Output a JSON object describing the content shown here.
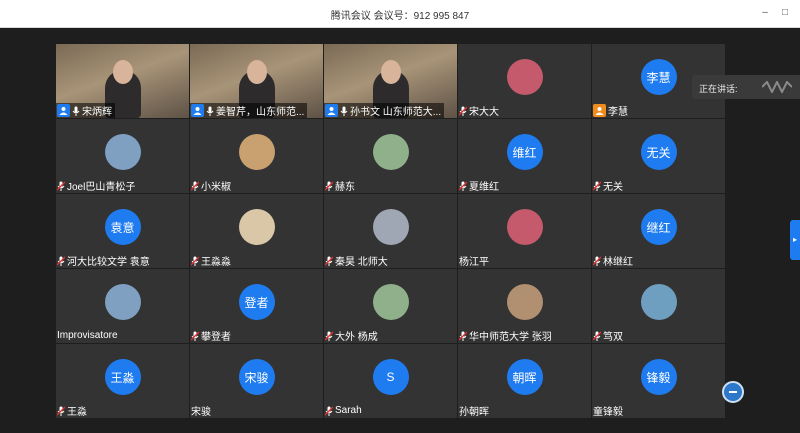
{
  "window": {
    "title": "腾讯会议 会议号：912 995 847",
    "minimize": "–",
    "maximize": "□"
  },
  "speaking": {
    "label": "正在讲话:"
  },
  "colors": {
    "avatar_blue": "#1f7cf0",
    "tile_bg": "#333334",
    "stage_bg": "#1e1e1e",
    "host_orange": "#f08c1e"
  },
  "participants": [
    {
      "name": "宋炳辉",
      "kind": "video",
      "host": true,
      "mic": "on"
    },
    {
      "name": "姜智芹，山东师范...",
      "kind": "video",
      "host": true,
      "mic": "on"
    },
    {
      "name": "孙书文 山东师范大...",
      "kind": "video",
      "host": true,
      "mic": "on"
    },
    {
      "name": "宋大大",
      "kind": "photo",
      "mic": "muted"
    },
    {
      "name": "李慧",
      "kind": "text",
      "avatar_text": "李慧",
      "host_orange": true
    },
    {
      "name": "Joel巴山青松子",
      "kind": "photo",
      "mic": "muted"
    },
    {
      "name": "小米椒",
      "kind": "photo",
      "mic": "muted"
    },
    {
      "name": "赫东",
      "kind": "photo",
      "mic": "muted"
    },
    {
      "name": "夏维红",
      "kind": "text",
      "avatar_text": "维红",
      "mic": "muted"
    },
    {
      "name": "无关",
      "kind": "text",
      "avatar_text": "无关",
      "mic": "muted"
    },
    {
      "name": "河大比较文学 袁意",
      "kind": "text",
      "avatar_text": "袁意",
      "mic": "muted"
    },
    {
      "name": "王淼淼",
      "kind": "photo",
      "mic": "muted"
    },
    {
      "name": "秦昊 北师大",
      "kind": "photo",
      "mic": "muted"
    },
    {
      "name": "杨江平",
      "kind": "photo"
    },
    {
      "name": "林继红",
      "kind": "text",
      "avatar_text": "继红",
      "mic": "muted"
    },
    {
      "name": "Improvisatore",
      "kind": "photo"
    },
    {
      "name": "攀登者",
      "kind": "text",
      "avatar_text": "登者",
      "mic": "muted"
    },
    {
      "name": "大外  杨成",
      "kind": "photo",
      "mic": "muted"
    },
    {
      "name": "华中师范大学 张羽",
      "kind": "photo",
      "mic": "muted"
    },
    {
      "name": "笃双",
      "kind": "photo",
      "mic": "muted"
    },
    {
      "name": "王淼",
      "kind": "text",
      "avatar_text": "王淼",
      "mic": "muted"
    },
    {
      "name": "宋骏",
      "kind": "text",
      "avatar_text": "宋骏"
    },
    {
      "name": "Sarah",
      "kind": "text",
      "avatar_text": "S",
      "mic": "muted"
    },
    {
      "name": "孙朝晖",
      "kind": "text",
      "avatar_text": "朝晖"
    },
    {
      "name": "童锋毅",
      "kind": "text",
      "avatar_text": "锋毅"
    }
  ]
}
